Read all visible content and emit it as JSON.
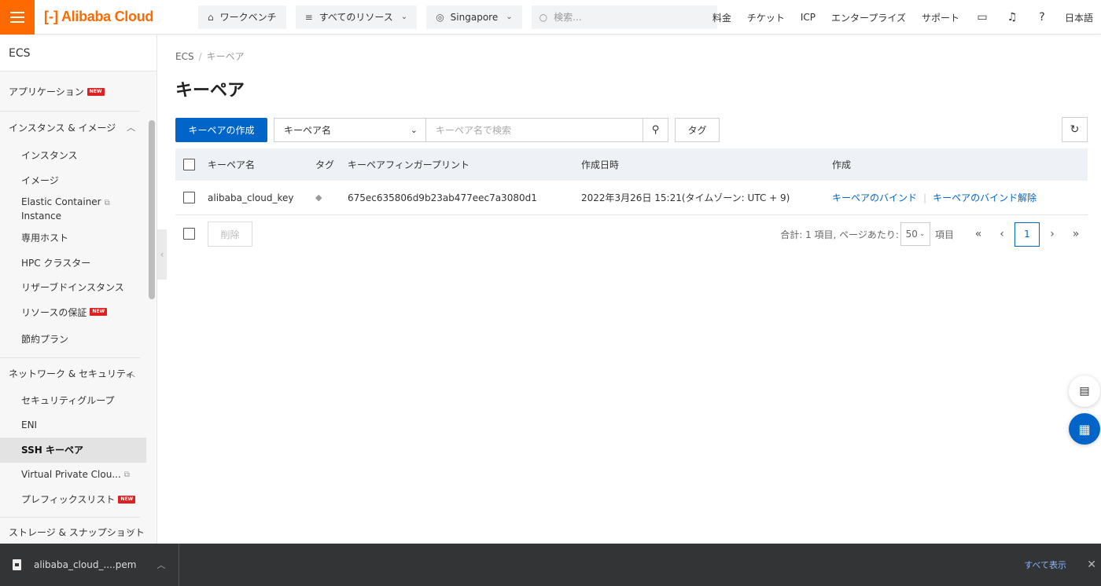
{
  "topbar": {
    "logo_text": "Alibaba Cloud",
    "workbench": "ワークベンチ",
    "all_resources": "すべてのリソース",
    "region": "Singapore",
    "search_placeholder": "検索...",
    "links": [
      "料金",
      "チケット",
      "ICP",
      "エンタープライズ",
      "サポート"
    ],
    "language": "日本語"
  },
  "sidebar": {
    "title": "ECS",
    "app_label": "アプリケーション",
    "groups": {
      "instances": "インスタンス & イメージ",
      "network": "ネットワーク & セキュリティ",
      "storage": "ストレージ & スナップショット"
    },
    "items": {
      "instances": "インスタンス",
      "images": "イメージ",
      "eci_line1": "Elastic Container",
      "eci_line2": "Instance",
      "dedicated_hosts": "専用ホスト",
      "hpc": "HPC クラスター",
      "reserved": "リザーブドインスタンス",
      "resource_assurance": "リソースの保証",
      "savings_plan": "節約プラン",
      "security_group": "セキュリティグループ",
      "eni": "ENI",
      "ssh_keypair": "SSH キーペア",
      "vpc": "Virtual Private Clou...",
      "prefix_list": "プレフィックスリスト"
    },
    "new_badge": "NEW"
  },
  "breadcrumb": {
    "root": "ECS",
    "current": "キーペア"
  },
  "page_title": "キーペア",
  "toolbar": {
    "create_label": "キーペアの作成",
    "filter_select": "キーペア名",
    "search_placeholder": "キーペア名で検索",
    "tag_label": "タグ"
  },
  "table": {
    "headers": {
      "name": "キーペア名",
      "tag": "タグ",
      "fingerprint": "キーペアフィンガープリント",
      "created": "作成日時",
      "actions": "作成"
    },
    "rows": [
      {
        "name": "alibaba_cloud_key",
        "fingerprint": "675ec635806d9b23ab477eec7a3080d1",
        "created": "2022年3月26日 15:21(タイムゾーン: UTC + 9)",
        "action_bind": "キーペアのバインド",
        "action_unbind": "キーペアのバインド解除"
      }
    ]
  },
  "footer": {
    "delete_label": "削除",
    "total_text": "合計: 1 項目, ページあたり:",
    "page_size": "50",
    "items_label": "項目",
    "current_page": "1"
  },
  "download_bar": {
    "filename": "alibaba_cloud_....pem",
    "show_all": "すべて表示"
  },
  "colors": {
    "brand": "#ff6a00",
    "primary": "#0064c8"
  }
}
